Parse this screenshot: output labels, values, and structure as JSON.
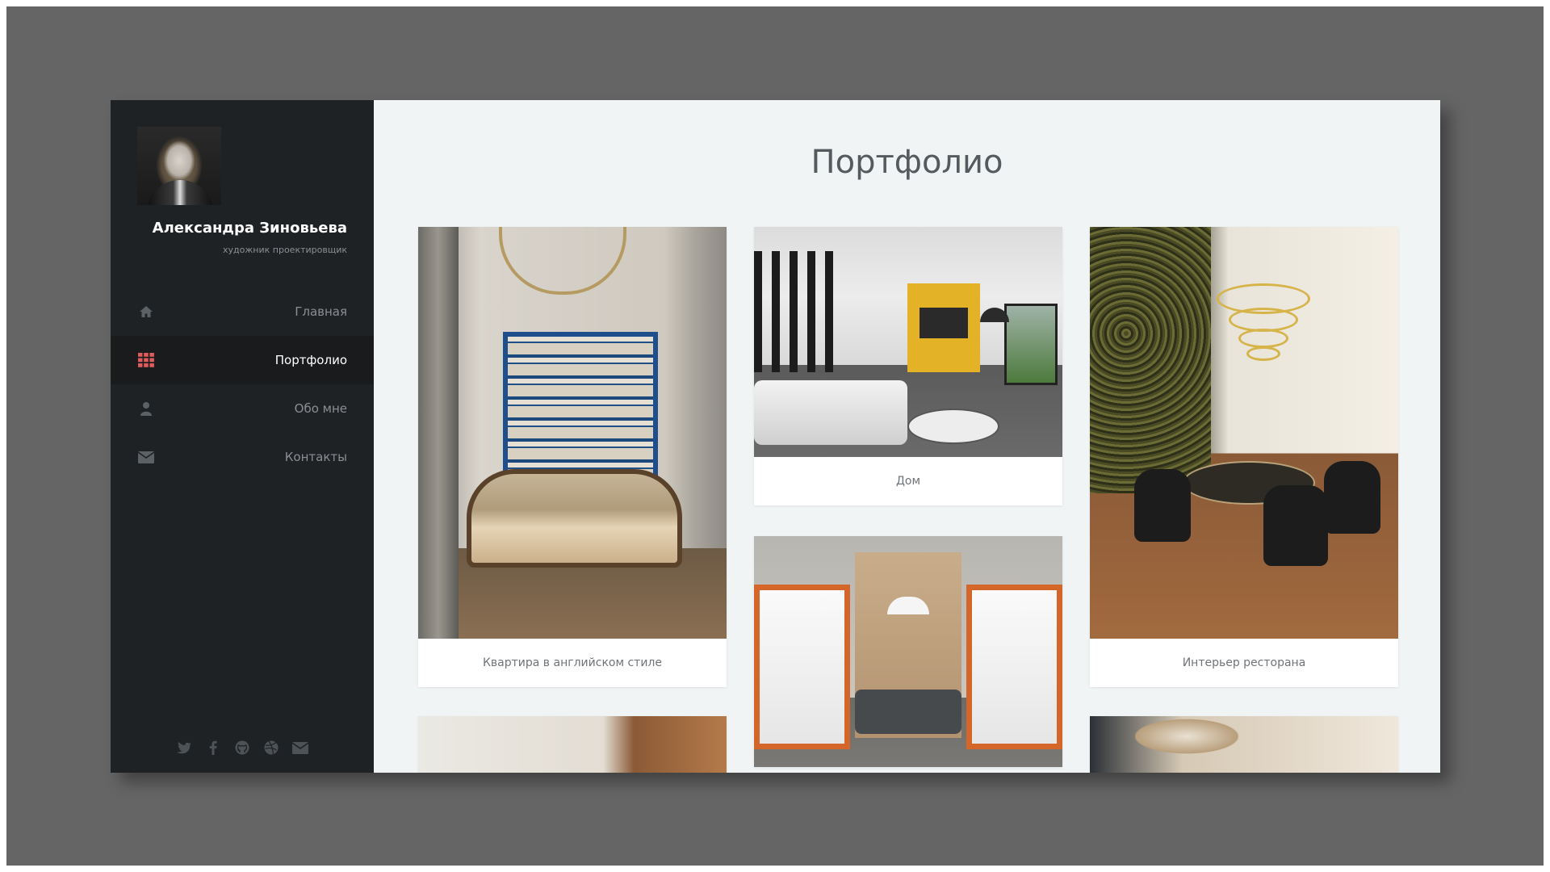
{
  "profile": {
    "name": "Александра Зиновьева",
    "role": "художник проектировщик",
    "avatar_icon": "profile-photo"
  },
  "nav": {
    "items": [
      {
        "label": "Главная",
        "icon": "home-icon",
        "active": false
      },
      {
        "label": "Портфолио",
        "icon": "grid-icon",
        "active": true
      },
      {
        "label": "Обо мне",
        "icon": "user-icon",
        "active": false
      },
      {
        "label": "Контакты",
        "icon": "envelope-icon",
        "active": false
      }
    ]
  },
  "social": [
    "twitter-icon",
    "facebook-icon",
    "github-icon",
    "dribbble-icon",
    "mail-icon"
  ],
  "main": {
    "title": "Портфолио",
    "cards": [
      {
        "caption": "Квартира в английском стиле"
      },
      {
        "caption": "Дом"
      },
      {
        "caption": "Интерьер ресторана"
      },
      {
        "caption": ""
      },
      {
        "caption": ""
      },
      {
        "caption": ""
      }
    ]
  },
  "colors": {
    "sidebar_bg": "#1f2224",
    "sidebar_active_bg": "#191b1d",
    "accent_icon": "#e05b5b",
    "main_bg": "#f1f4f5",
    "backdrop": "#656565"
  }
}
